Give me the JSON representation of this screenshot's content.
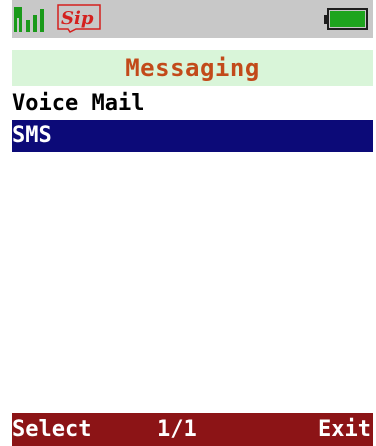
{
  "status_bar": {
    "signal_icon": "signal-strength-icon",
    "logo_text": "Sip",
    "battery_icon": "battery-full-icon",
    "battery_color": "#1ea41e"
  },
  "title": "Messaging",
  "menu": {
    "items": [
      {
        "label": "Voice Mail",
        "selected": false
      },
      {
        "label": "SMS",
        "selected": true
      }
    ]
  },
  "softkeys": {
    "left": "Select",
    "page": "1/1",
    "right": "Exit"
  },
  "colors": {
    "status_bar_bg": "#c8c8c8",
    "title_bg": "#d9f5d9",
    "title_text": "#c24a1a",
    "selection_bg": "#0c0a78",
    "softkey_bg": "#8c1416"
  }
}
